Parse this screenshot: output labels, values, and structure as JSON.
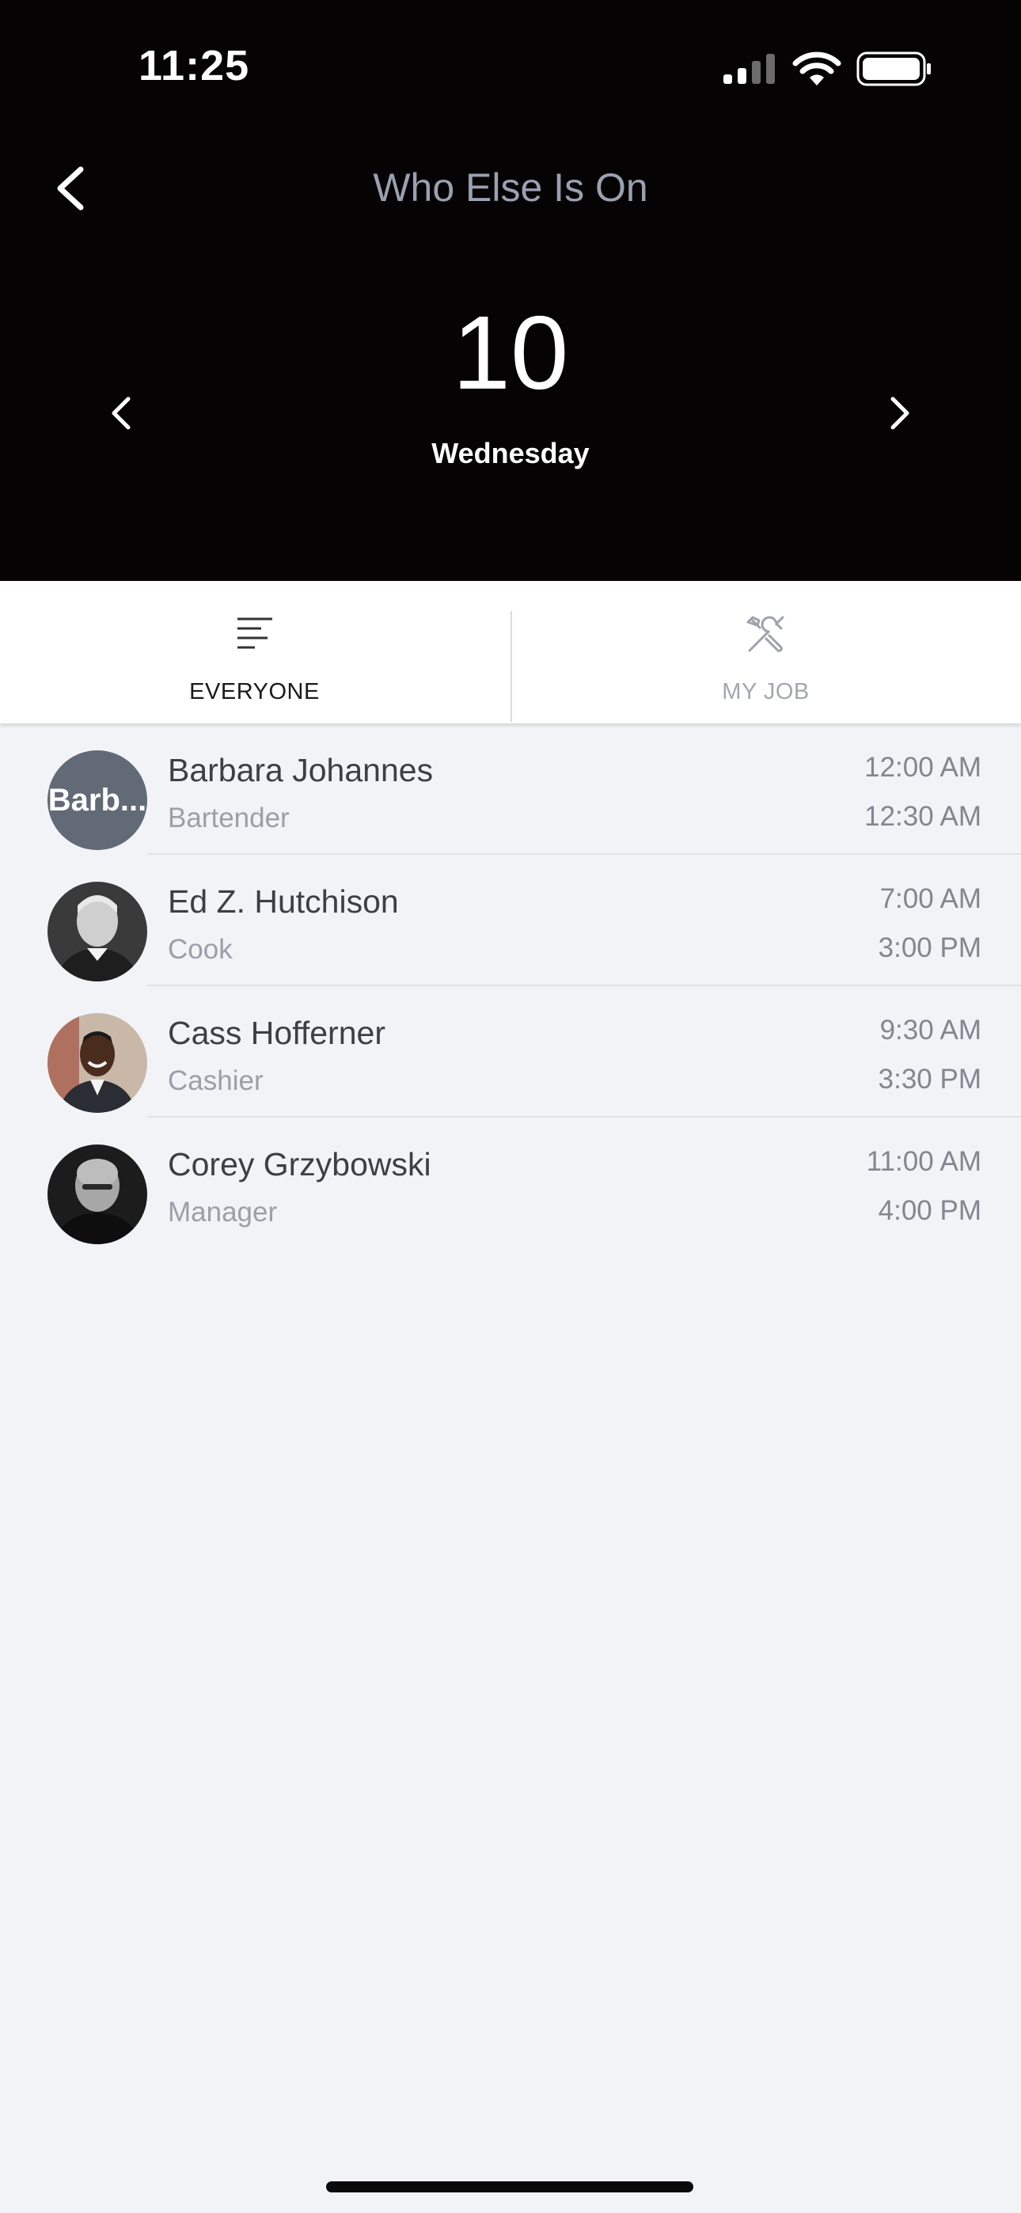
{
  "status_bar": {
    "time": "11:25"
  },
  "header": {
    "title": "Who Else Is On",
    "date_number": "10",
    "weekday": "Wednesday"
  },
  "tabs": [
    {
      "label": "EVERYONE",
      "icon": "list-icon",
      "active": true
    },
    {
      "label": "MY JOB",
      "icon": "tools-icon",
      "active": false
    }
  ],
  "shifts": [
    {
      "name": "Barbara Johannes",
      "role": "Bartender",
      "start": "12:00 AM",
      "end": "12:30 AM",
      "avatar": "Barb..."
    },
    {
      "name": "Ed Z. Hutchison",
      "role": "Cook",
      "start": "7:00 AM",
      "end": "3:00 PM",
      "avatar": "photo"
    },
    {
      "name": "Cass Hofferner",
      "role": "Cashier",
      "start": "9:30 AM",
      "end": "3:30 PM",
      "avatar": "photo"
    },
    {
      "name": "Corey Grzybowski",
      "role": "Manager",
      "start": "11:00 AM",
      "end": "4:00 PM",
      "avatar": "photo"
    }
  ],
  "colors": {
    "header_bg": "#050304",
    "title_gray": "#9aa0b0",
    "list_bg": "#f2f3f7",
    "avatar_initials_bg": "#626a77"
  }
}
